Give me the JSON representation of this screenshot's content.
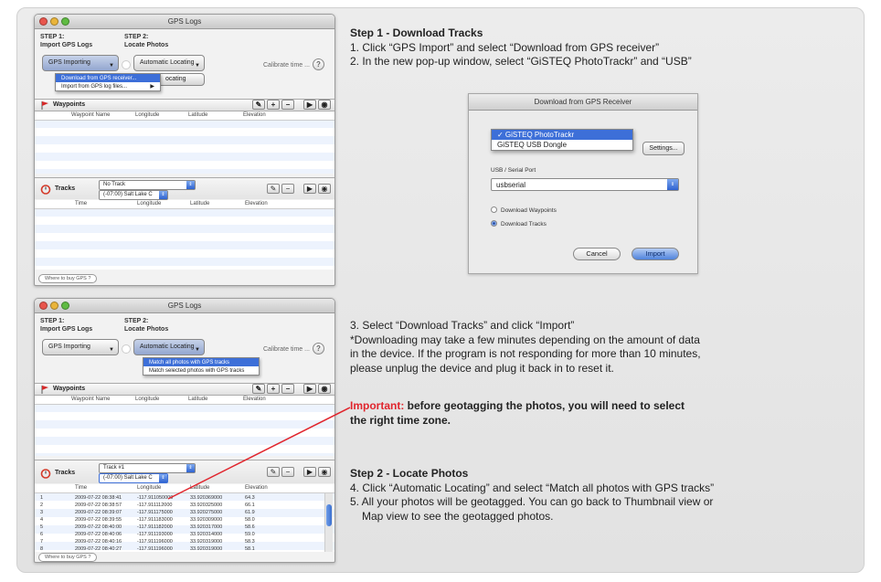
{
  "window1": {
    "title": "GPS Logs",
    "step1": [
      "STEP 1:",
      "Import GPS Logs"
    ],
    "step2": [
      "STEP 2:",
      "Locate Photos"
    ],
    "import_btn": "GPS Importing",
    "locate_btn": "Automatic Locating",
    "calibrate": "Calibrate time ...",
    "import_menu": [
      "Download from GPS receiver...",
      "Import from GPS log files..."
    ],
    "behind_menu": "ocating",
    "waypoints_label": "Waypoints",
    "waypoint_cols": [
      "Waypoint Name",
      "Longitude",
      "Latitude",
      "Elevation"
    ],
    "tracks_label": "Tracks",
    "track_select": "No Track",
    "timezone": "(-07:00) Salt Lake C",
    "track_cols": [
      "Time",
      "Longitude",
      "Latitude",
      "Elevation"
    ],
    "where_btn": "Where to buy GPS ?"
  },
  "window2": {
    "title": "GPS Logs",
    "step1": [
      "STEP 1:",
      "Import GPS Logs"
    ],
    "step2": [
      "STEP 2:",
      "Locate Photos"
    ],
    "import_btn": "GPS Importing",
    "locate_btn": "Automatic Locating",
    "calibrate": "Calibrate time ...",
    "locate_menu": [
      "Match all photos with GPS tracks",
      "Match selected photos with GPS tracks"
    ],
    "waypoints_label": "Waypoints",
    "waypoint_cols": [
      "Waypoint Name",
      "Longitude",
      "Latitude",
      "Elevation"
    ],
    "tracks_label": "Tracks",
    "track_select": "Track #1",
    "timezone": "(-07:00) Salt Lake C",
    "track_cols": [
      "Time",
      "Longitude",
      "Latitude",
      "Elevation"
    ],
    "rows": [
      [
        "1",
        "2009-07-22 08:38:41",
        "-117.911050000",
        "33.920369000",
        "64.3"
      ],
      [
        "2",
        "2009-07-22 08:38:57",
        "-117.911112000",
        "33.920325000",
        "66.1"
      ],
      [
        "3",
        "2009-07-22 08:39:07",
        "-117.911175000",
        "33.920275000",
        "61.9"
      ],
      [
        "4",
        "2009-07-22 08:39:55",
        "-117.911183000",
        "33.920309000",
        "58.0"
      ],
      [
        "5",
        "2009-07-22 08:40:00",
        "-117.911182000",
        "33.920317000",
        "58.6"
      ],
      [
        "6",
        "2009-07-22 08:40:06",
        "-117.911193000",
        "33.920314000",
        "59.0"
      ],
      [
        "7",
        "2009-07-22 08:40:16",
        "-117.911196000",
        "33.920319000",
        "58.3"
      ],
      [
        "8",
        "2009-07-22 08:40:27",
        "-117.911196000",
        "33.920319000",
        "58.1"
      ]
    ],
    "where_btn": "Where to buy GPS ?"
  },
  "dialog": {
    "title": "Download from GPS Receiver",
    "device_menu": [
      "✓ GiSTEQ PhotoTrackr",
      "GiSTEQ USB Dongle"
    ],
    "settings_btn": "Settings...",
    "port_label": "USB / Serial Port",
    "port_value": "usbserial",
    "radio1": "Download Waypoints",
    "radio2": "Download Tracks",
    "cancel_btn": "Cancel",
    "import_btn": "Import"
  },
  "instructions": {
    "step1_title": "Step 1 - Download Tracks",
    "step1_line1": "1. Click “GPS Import” and select “Download from GPS receiver”",
    "step1_line2": "2. In the new pop-up window, select “GiSTEQ PhotoTrackr” and “USB”",
    "step3_line1": "3. Select “Download Tracks” and click “Import”",
    "step3_line2": "*Downloading may take a few minutes depending on the amount of data",
    "step3_line3": "in the device. If the program is not responding for more than 10 minutes,",
    "step3_line4": "please unplug the device and plug it back in to reset it.",
    "important_label": "Important:",
    "important_text1": " before geotagging the photos, you will need to select",
    "important_text2": "the right time zone.",
    "step2_title": "Step 2 - Locate Photos",
    "step2_line1": "4. Click “Automatic Locating” and select “Match all photos with GPS tracks”",
    "step2_line2": "5. All your photos will be geotagged. You can go back to Thumbnail view or",
    "step2_line3": "Map view to see the geotagged photos."
  },
  "colors": {
    "accent": "#3d6fd8",
    "important": "#e0252d",
    "pointer_line": "#e0252d"
  }
}
